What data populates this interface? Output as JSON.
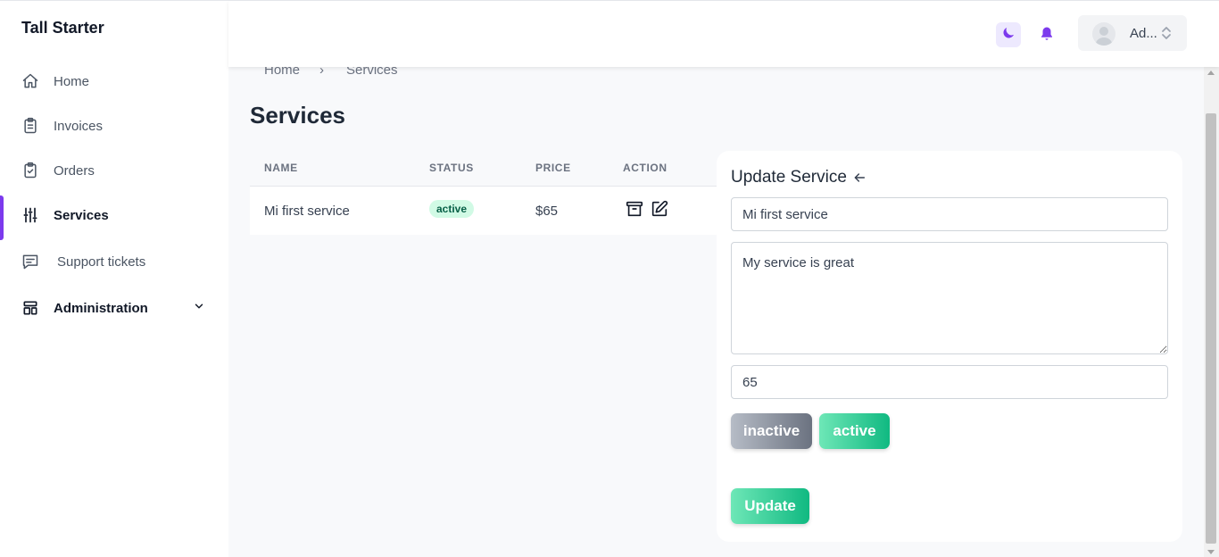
{
  "app": {
    "brand": "Tall Starter"
  },
  "sidebar": {
    "items": [
      {
        "label": "Home",
        "icon": "home-icon"
      },
      {
        "label": "Invoices",
        "icon": "clipboard-list-icon"
      },
      {
        "label": "Orders",
        "icon": "clipboard-check-icon"
      },
      {
        "label": "Services",
        "icon": "adjustments-icon",
        "active": true
      },
      {
        "label": "Support tickets",
        "icon": "chat-alt-icon"
      },
      {
        "label": "Administration",
        "icon": "template-icon",
        "expandable": true
      }
    ]
  },
  "header": {
    "user_name": "Ad...",
    "accent_color": "#7c3aed"
  },
  "breadcrumb": {
    "items": [
      "Home",
      "Services"
    ],
    "separator": "›"
  },
  "page": {
    "title": "Services"
  },
  "table": {
    "columns": [
      "NAME",
      "STATUS",
      "PRICE",
      "ACTION"
    ],
    "rows": [
      {
        "name": "Mi first service",
        "status": "active",
        "price": "$65"
      }
    ]
  },
  "panel": {
    "title": "Update Service",
    "name_value": "Mi first service",
    "description_value": "My service is great",
    "price_value": "65",
    "inactive_label": "inactive",
    "active_label": "active",
    "update_label": "Update"
  }
}
